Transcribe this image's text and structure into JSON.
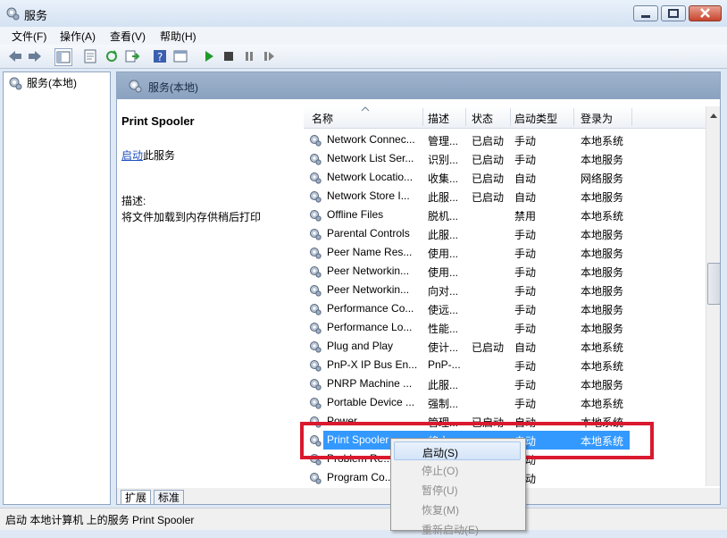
{
  "window": {
    "title": "服务"
  },
  "menu": [
    "文件(F)",
    "操作(A)",
    "查看(V)",
    "帮助(H)"
  ],
  "tree": {
    "root_label": "服务(本地)"
  },
  "main": {
    "header_title": "服务(本地)",
    "selected_service": "Print Spooler",
    "start_link": "启动",
    "start_suffix": "此服务",
    "desc_label": "描述:",
    "desc_text": "将文件加载到内存供稍后打印"
  },
  "list": {
    "columns": [
      "名称",
      "描述",
      "状态",
      "启动类型",
      "登录为"
    ],
    "rows": [
      {
        "name": "Network Connec...",
        "desc": "管理...",
        "status": "已启动",
        "start": "手动",
        "logon": "本地系统"
      },
      {
        "name": "Network List Ser...",
        "desc": "识别...",
        "status": "已启动",
        "start": "手动",
        "logon": "本地服务"
      },
      {
        "name": "Network Locatio...",
        "desc": "收集...",
        "status": "已启动",
        "start": "自动",
        "logon": "网络服务"
      },
      {
        "name": "Network Store I...",
        "desc": "此服...",
        "status": "已启动",
        "start": "自动",
        "logon": "本地服务"
      },
      {
        "name": "Offline Files",
        "desc": "脱机...",
        "status": "",
        "start": "禁用",
        "logon": "本地系统"
      },
      {
        "name": "Parental Controls",
        "desc": "此服...",
        "status": "",
        "start": "手动",
        "logon": "本地服务"
      },
      {
        "name": "Peer Name Res...",
        "desc": "使用...",
        "status": "",
        "start": "手动",
        "logon": "本地服务"
      },
      {
        "name": "Peer Networkin...",
        "desc": "使用...",
        "status": "",
        "start": "手动",
        "logon": "本地服务"
      },
      {
        "name": "Peer Networkin...",
        "desc": "向对...",
        "status": "",
        "start": "手动",
        "logon": "本地服务"
      },
      {
        "name": "Performance Co...",
        "desc": "使远...",
        "status": "",
        "start": "手动",
        "logon": "本地服务"
      },
      {
        "name": "Performance Lo...",
        "desc": "性能...",
        "status": "",
        "start": "手动",
        "logon": "本地服务"
      },
      {
        "name": "Plug and Play",
        "desc": "使计...",
        "status": "已启动",
        "start": "自动",
        "logon": "本地系统"
      },
      {
        "name": "PnP-X IP Bus En...",
        "desc": "PnP-...",
        "status": "",
        "start": "手动",
        "logon": "本地系统"
      },
      {
        "name": "PNRP Machine ...",
        "desc": "此服...",
        "status": "",
        "start": "手动",
        "logon": "本地服务"
      },
      {
        "name": "Portable Device ...",
        "desc": "强制...",
        "status": "",
        "start": "手动",
        "logon": "本地系统"
      },
      {
        "name": "Power",
        "desc": "管理...",
        "status": "已启动",
        "start": "自动",
        "logon": "本地系统"
      },
      {
        "name": "Print Spooler",
        "desc": "将文...",
        "status": "",
        "start": "自动",
        "logon": "本地系统"
      },
      {
        "name": "Problem Re...",
        "desc": "",
        "status": "",
        "start": "手动",
        "logon": ""
      },
      {
        "name": "Program Co...",
        "desc": "",
        "status": "",
        "start": "手动",
        "logon": ""
      }
    ]
  },
  "tabs": [
    "扩展",
    "标准"
  ],
  "context_menu": [
    "启动(S)",
    "停止(O)",
    "暂停(U)",
    "恢复(M)",
    "重新启动(E)"
  ],
  "status": "启动 本地计算机 上的服务 Print Spooler",
  "colors": {
    "highlight_box": "#d9192e",
    "selection": "#3399ff"
  }
}
